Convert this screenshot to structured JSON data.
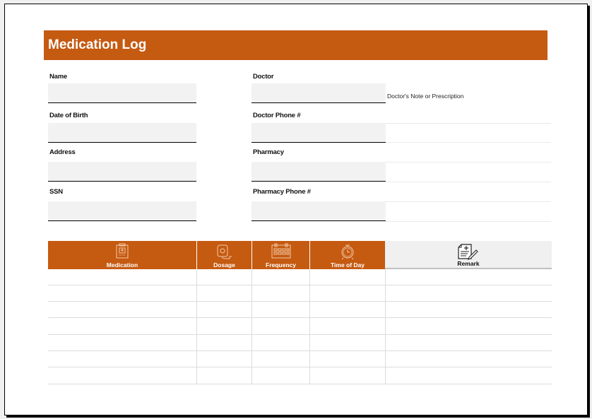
{
  "header": {
    "title": "Medication Log",
    "accent_color": "#c55a11"
  },
  "patient_fields": [
    {
      "label": "Name",
      "value": ""
    },
    {
      "label": "Date of Birth",
      "value": ""
    },
    {
      "label": "Address",
      "value": ""
    },
    {
      "label": "SSN",
      "value": ""
    }
  ],
  "provider_fields": [
    {
      "label": "Doctor",
      "value": ""
    },
    {
      "label": "Doctor Phone #",
      "value": ""
    },
    {
      "label": "Pharmacy",
      "value": ""
    },
    {
      "label": "Pharmacy Phone #",
      "value": ""
    }
  ],
  "notes": {
    "label": "Doctor's Note or Prescription"
  },
  "table": {
    "columns": [
      {
        "label": "Medication",
        "icon": "clipboard-icon"
      },
      {
        "label": "Dosage",
        "icon": "iv-bag-icon"
      },
      {
        "label": "Frequency",
        "icon": "calendar-icon"
      },
      {
        "label": "Time of Day",
        "icon": "alarm-clock-icon"
      },
      {
        "label": "Remark",
        "icon": "note-pencil-icon"
      }
    ],
    "rows": [
      [
        "",
        "",
        "",
        "",
        ""
      ],
      [
        "",
        "",
        "",
        "",
        ""
      ],
      [
        "",
        "",
        "",
        "",
        ""
      ],
      [
        "",
        "",
        "",
        "",
        ""
      ],
      [
        "",
        "",
        "",
        "",
        ""
      ],
      [
        "",
        "",
        "",
        "",
        ""
      ],
      [
        "",
        "",
        "",
        "",
        ""
      ]
    ]
  }
}
